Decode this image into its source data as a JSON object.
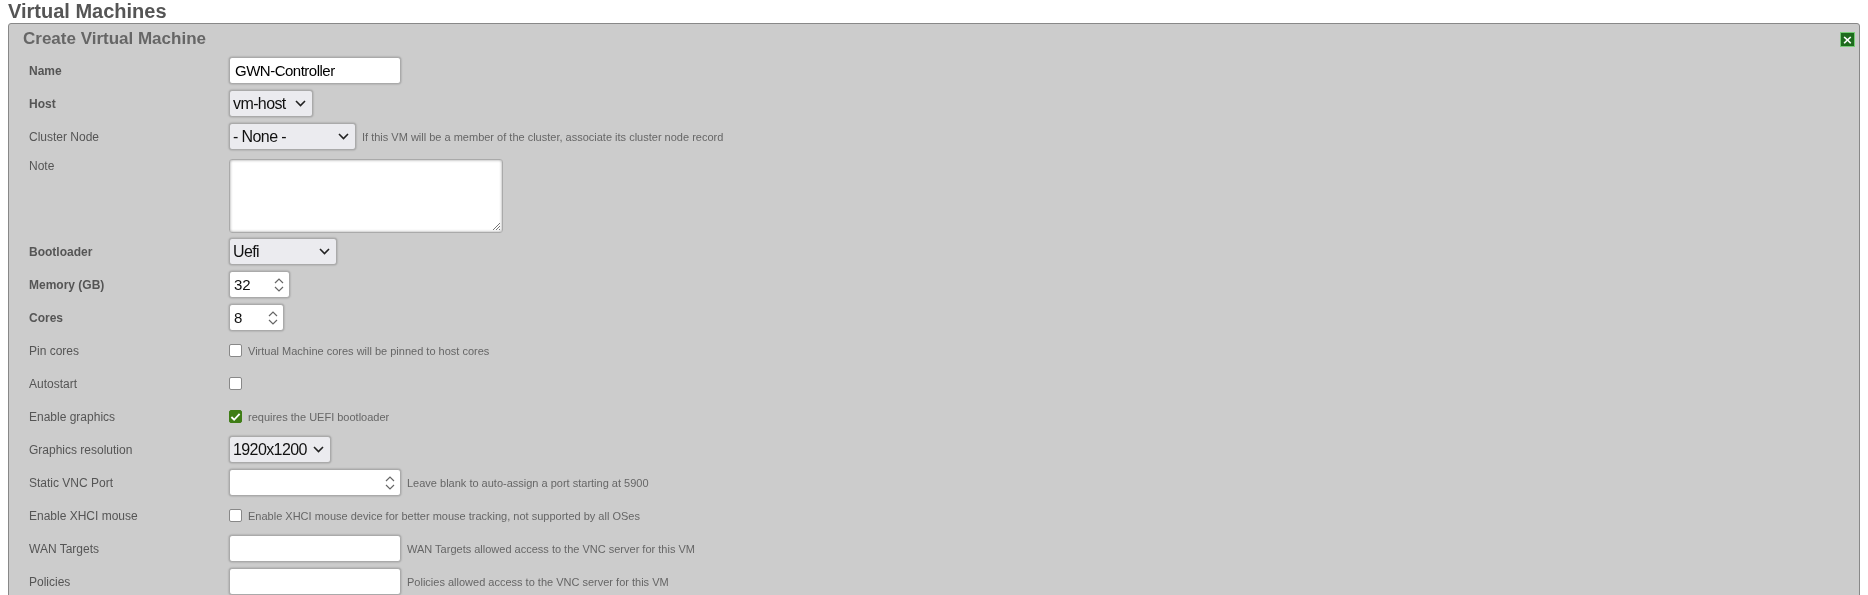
{
  "page": {
    "heading": "Virtual Machines"
  },
  "panel": {
    "title": "Create Virtual Machine",
    "close": "×"
  },
  "fields": [
    {
      "kind": "text",
      "label": "Name",
      "bold": true,
      "value": "GWN-Controller"
    },
    {
      "kind": "select",
      "label": "Host",
      "bold": true,
      "value": "vm-host"
    },
    {
      "kind": "select",
      "label": "Cluster Node",
      "bold": false,
      "value": "- None -",
      "hint": "If this VM will be a member of the cluster, associate its cluster node record"
    },
    {
      "kind": "textarea",
      "label": "Note",
      "bold": false
    },
    {
      "kind": "select",
      "label": "Bootloader",
      "bold": true,
      "value": "Uefi"
    },
    {
      "kind": "number",
      "label": "Memory (GB)",
      "bold": true,
      "value": "32"
    },
    {
      "kind": "number",
      "label": "Cores",
      "bold": true,
      "value": "8"
    },
    {
      "kind": "checkbox",
      "label": "Pin cores",
      "bold": false,
      "checked": false,
      "hint": "Virtual Machine cores will be pinned to host cores"
    },
    {
      "kind": "checkbox",
      "label": "Autostart",
      "bold": false,
      "checked": false
    },
    {
      "kind": "checkbox",
      "label": "Enable graphics",
      "bold": false,
      "checked": true,
      "hint": "requires the UEFI bootloader"
    },
    {
      "kind": "select",
      "label": "Graphics resolution",
      "bold": false,
      "value": "1920x1200"
    },
    {
      "kind": "number",
      "label": "Static VNC Port",
      "bold": false,
      "hint": "Leave blank to auto-assign a port starting at 5900"
    },
    {
      "kind": "checkbox",
      "label": "Enable XHCI mouse",
      "bold": false,
      "checked": false,
      "hint": "Enable XHCI mouse device for better mouse tracking, not supported by all OSes"
    },
    {
      "kind": "text",
      "label": "WAN Targets",
      "bold": false,
      "hint": "WAN Targets allowed access to the VNC server for this VM"
    },
    {
      "kind": "text",
      "label": "Policies",
      "bold": false,
      "hint": "Policies allowed access to the VNC server for this VM"
    }
  ]
}
